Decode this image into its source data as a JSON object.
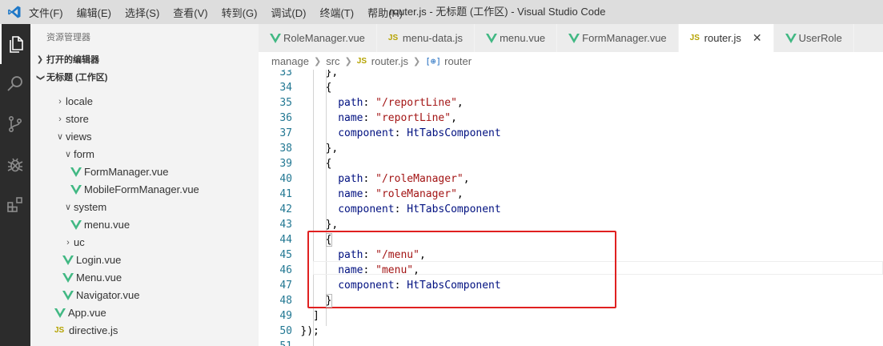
{
  "titlebar": {
    "menu": [
      "文件(F)",
      "编辑(E)",
      "选择(S)",
      "查看(V)",
      "转到(G)",
      "调试(D)",
      "终端(T)",
      "帮助(H)"
    ],
    "window_title": "router.js - 无标题 (工作区) - Visual Studio Code"
  },
  "activity_bar": [
    "files-icon",
    "search-icon",
    "source-control-icon",
    "debug-icon",
    "extensions-icon"
  ],
  "sidebar": {
    "header": "资源管理器",
    "open_editors": "打开的编辑器",
    "workspace": "无标题 (工作区)",
    "tree": [
      {
        "label": "locale",
        "type": "folder",
        "indent": 1,
        "expanded": false
      },
      {
        "label": "store",
        "type": "folder",
        "indent": 1,
        "expanded": false
      },
      {
        "label": "views",
        "type": "folder",
        "indent": 1,
        "expanded": true
      },
      {
        "label": "form",
        "type": "folder",
        "indent": 2,
        "expanded": true
      },
      {
        "label": "FormManager.vue",
        "type": "vue",
        "indent": 3
      },
      {
        "label": "MobileFormManager.vue",
        "type": "vue",
        "indent": 3
      },
      {
        "label": "system",
        "type": "folder",
        "indent": 2,
        "expanded": true
      },
      {
        "label": "menu.vue",
        "type": "vue",
        "indent": 3
      },
      {
        "label": "uc",
        "type": "folder",
        "indent": 2,
        "expanded": false
      },
      {
        "label": "Login.vue",
        "type": "vue",
        "indent": 2
      },
      {
        "label": "Menu.vue",
        "type": "vue",
        "indent": 2
      },
      {
        "label": "Navigator.vue",
        "type": "vue",
        "indent": 2
      },
      {
        "label": "App.vue",
        "type": "vue",
        "indent": 1
      },
      {
        "label": "directive.js",
        "type": "js",
        "indent": 1
      }
    ]
  },
  "tabs": [
    {
      "label": "RoleManager.vue",
      "type": "vue",
      "active": false
    },
    {
      "label": "menu-data.js",
      "type": "js",
      "active": false
    },
    {
      "label": "menu.vue",
      "type": "vue",
      "active": false
    },
    {
      "label": "FormManager.vue",
      "type": "vue",
      "active": false
    },
    {
      "label": "router.js",
      "type": "js",
      "active": true
    },
    {
      "label": "UserRole",
      "type": "vue",
      "active": false
    }
  ],
  "breadcrumb": {
    "parts": [
      "manage",
      "src",
      "router.js",
      "router"
    ],
    "js_badge": "JS",
    "symbol_badge": "[⊕]"
  },
  "editor": {
    "lines": [
      {
        "n": "33",
        "indent": 2,
        "tokens": [
          [
            "p",
            "},"
          ]
        ]
      },
      {
        "n": "34",
        "indent": 2,
        "tokens": [
          [
            "p",
            "{"
          ]
        ]
      },
      {
        "n": "35",
        "indent": 3,
        "tokens": [
          [
            "k",
            "path"
          ],
          [
            "p",
            ": "
          ],
          [
            "s",
            "\"/reportLine\""
          ],
          [
            "p",
            ","
          ]
        ]
      },
      {
        "n": "36",
        "indent": 3,
        "tokens": [
          [
            "k",
            "name"
          ],
          [
            "p",
            ": "
          ],
          [
            "s",
            "\"reportLine\""
          ],
          [
            "p",
            ","
          ]
        ]
      },
      {
        "n": "37",
        "indent": 3,
        "tokens": [
          [
            "k",
            "component"
          ],
          [
            "p",
            ": "
          ],
          [
            "i",
            "HtTabsComponent"
          ]
        ]
      },
      {
        "n": "38",
        "indent": 2,
        "tokens": [
          [
            "p",
            "},"
          ]
        ]
      },
      {
        "n": "39",
        "indent": 2,
        "tokens": [
          [
            "p",
            "{"
          ]
        ]
      },
      {
        "n": "40",
        "indent": 3,
        "tokens": [
          [
            "k",
            "path"
          ],
          [
            "p",
            ": "
          ],
          [
            "s",
            "\"/roleManager\""
          ],
          [
            "p",
            ","
          ]
        ]
      },
      {
        "n": "41",
        "indent": 3,
        "tokens": [
          [
            "k",
            "name"
          ],
          [
            "p",
            ": "
          ],
          [
            "s",
            "\"roleManager\""
          ],
          [
            "p",
            ","
          ]
        ]
      },
      {
        "n": "42",
        "indent": 3,
        "tokens": [
          [
            "k",
            "component"
          ],
          [
            "p",
            ": "
          ],
          [
            "i",
            "HtTabsComponent"
          ]
        ]
      },
      {
        "n": "43",
        "indent": 2,
        "tokens": [
          [
            "p",
            "},"
          ]
        ]
      },
      {
        "n": "44",
        "indent": 2,
        "tokens": [
          [
            "p",
            "{"
          ]
        ]
      },
      {
        "n": "45",
        "indent": 3,
        "tokens": [
          [
            "k",
            "path"
          ],
          [
            "p",
            ": "
          ],
          [
            "s",
            "\"/menu\""
          ],
          [
            "p",
            ","
          ]
        ]
      },
      {
        "n": "46",
        "indent": 3,
        "tokens": [
          [
            "k",
            "name"
          ],
          [
            "p",
            ": "
          ],
          [
            "s",
            "\"menu\""
          ],
          [
            "p",
            ","
          ]
        ]
      },
      {
        "n": "47",
        "indent": 3,
        "tokens": [
          [
            "k",
            "component"
          ],
          [
            "p",
            ": "
          ],
          [
            "i",
            "HtTabsComponent"
          ]
        ]
      },
      {
        "n": "48",
        "indent": 2,
        "tokens": [
          [
            "p",
            "}"
          ]
        ]
      },
      {
        "n": "49",
        "indent": 1,
        "tokens": [
          [
            "p",
            "]"
          ]
        ]
      },
      {
        "n": "50",
        "indent": 0,
        "tokens": [
          [
            "p",
            "});"
          ]
        ]
      },
      {
        "n": "51",
        "indent": 0,
        "tokens": []
      }
    ]
  },
  "colors": {
    "activity_bar": "#2c2c2c",
    "title_bar": "#dddddd",
    "sidebar": "#f3f3f3",
    "vue_green": "#41b883",
    "js_yellow": "#b5a300",
    "highlight_red": "#e02020",
    "string": "#a31515",
    "property": "#001080",
    "line_number": "#237893"
  }
}
